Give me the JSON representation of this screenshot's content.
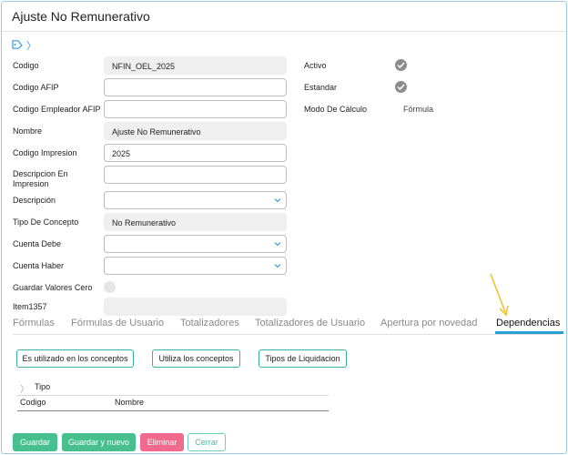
{
  "title": "Ajuste No Remunerativo",
  "header_icons": {
    "tag": "tag-icon",
    "chevron": "〉"
  },
  "form": {
    "codigo": {
      "label": "Codigo",
      "value": "NFIN_OEL_2025"
    },
    "codigo_afip": {
      "label": "Codigo AFIP",
      "value": ""
    },
    "codigo_empleador_afip": {
      "label": "Codigo Empleador AFIP",
      "value": ""
    },
    "nombre": {
      "label": "Nombre",
      "value": "Ajuste No Remunerativo"
    },
    "codigo_impresion": {
      "label": "Codigo Impresion",
      "value": "2025"
    },
    "descripcion_en_impresion": {
      "label": "Descripcion En Impresion",
      "value": ""
    },
    "descripcion": {
      "label": "Descripción",
      "value": ""
    },
    "tipo_de_concepto": {
      "label": "Tipo De Concepto",
      "value": "No Remunerativo"
    },
    "cuenta_debe": {
      "label": "Cuenta Debe",
      "value": ""
    },
    "cuenta_haber": {
      "label": "Cuenta Haber",
      "value": ""
    },
    "guardar_valores_cero": {
      "label": "Guardar Valores Cero",
      "checked": false
    },
    "item1357": {
      "label": "Item1357",
      "value": ""
    }
  },
  "right": {
    "activo": {
      "label": "Activo",
      "checked": true
    },
    "estandar": {
      "label": "Estandar",
      "checked": true
    },
    "modo_de_calculo": {
      "label": "Modo De Cálculo",
      "value": "Fórmula"
    }
  },
  "tabs": [
    {
      "label": "Fórmulas",
      "active": false
    },
    {
      "label": "Fórmulas de Usuario",
      "active": false
    },
    {
      "label": "Totalizadores",
      "active": false
    },
    {
      "label": "Totalizadores de Usuario",
      "active": false
    },
    {
      "label": "Apertura por novedad",
      "active": false
    },
    {
      "label": "Dependencias",
      "active": true
    }
  ],
  "dependencias": {
    "buttons": [
      "Es utilizado en los conceptos",
      "Utiliza los conceptos",
      "Tipos de Liquidacion"
    ],
    "group_label": "Tipo",
    "columns": [
      "Codigo",
      "Nombre"
    ]
  },
  "footer": {
    "guardar": "Guardar",
    "guardar_y_nuevo": "Guardar y nuevo",
    "eliminar": "Eliminar",
    "cerrar": "Cerrar"
  },
  "colors": {
    "accent": "#2b9fd3",
    "green": "#47bf8f",
    "red": "#f06a8e",
    "arrow": "#f2c12e"
  }
}
